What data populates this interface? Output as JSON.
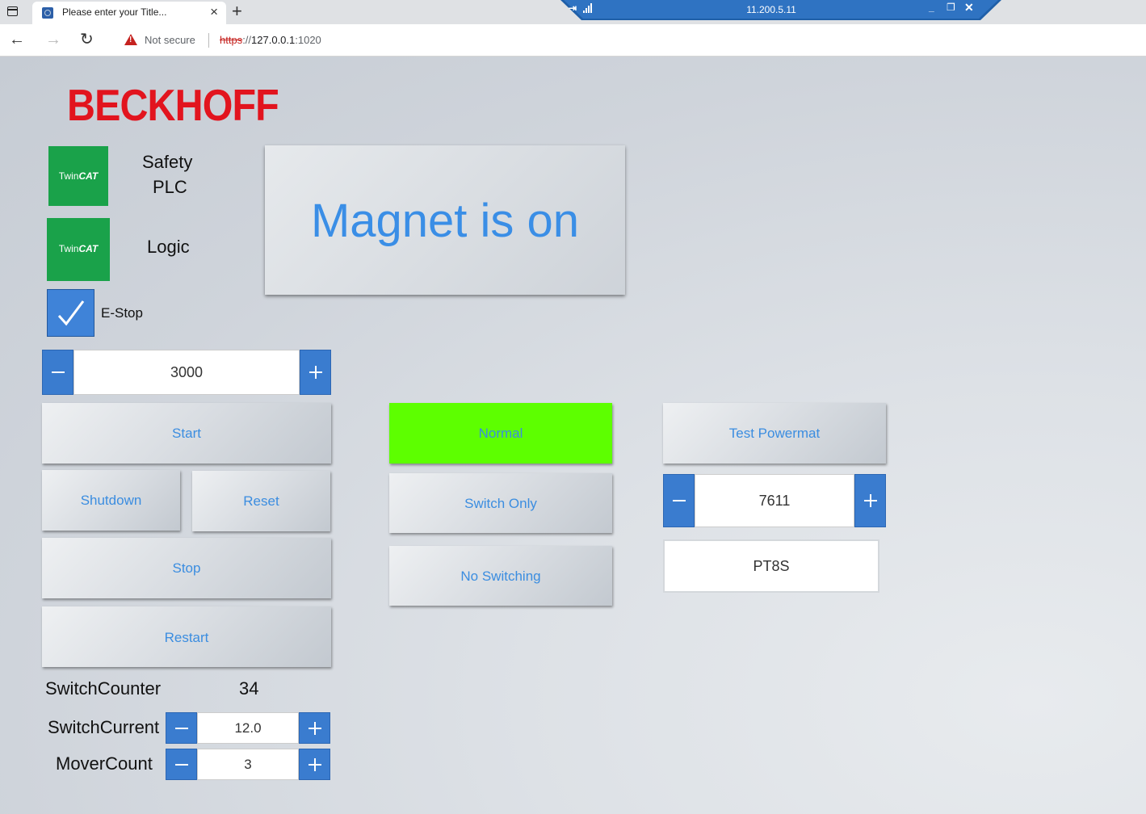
{
  "browser": {
    "tab_title": "Please enter your Title...",
    "tab_close": "×",
    "new_tab": "+",
    "rdp_host": "11.200.5.11",
    "security_label": "Not secure",
    "url_scheme": "https",
    "url_rest": "://",
    "url_host": "127.0.0.1",
    "url_port": ":1020",
    "nav": {
      "back": "←",
      "forward": "→",
      "reload": "↻"
    },
    "rdp": {
      "pin": "⇥",
      "minimize": "_",
      "restore": "❐",
      "close": "✕"
    }
  },
  "hmi": {
    "logo_text": "BECKHOFF",
    "twincat_tile_1": {
      "prefix": "Twin",
      "suffix": "CAT"
    },
    "twincat_tile_2": {
      "prefix": "Twin",
      "suffix": "CAT"
    },
    "safety_label_line1": "Safety",
    "safety_label_line2": "PLC",
    "logic_label": "Logic",
    "status_banner": "Magnet is on",
    "estop": {
      "label": "E-Stop",
      "checked": true
    },
    "setpoint_value": "3000",
    "buttons": {
      "start": "Start",
      "shutdown": "Shutdown",
      "reset": "Reset",
      "stop": "Stop",
      "restart": "Restart",
      "normal": "Normal",
      "switch_only": "Switch Only",
      "no_switching": "No Switching",
      "test_powermat": "Test Powermat"
    },
    "powermat_value": "7611",
    "pt_text": "PT8S",
    "switch_counter_label": "SwitchCounter",
    "switch_counter_value": "34",
    "switch_current_label": "SwitchCurrent",
    "switch_current_value": "12.0",
    "mover_count_label": "MoverCount",
    "mover_count_value": "3",
    "colors": {
      "accent_blue": "#3a7ccf",
      "button_text": "#3b8de0",
      "active_mode": "#5dff00",
      "twincat_green": "#1aa24a",
      "logo_red": "#e2141e"
    }
  }
}
